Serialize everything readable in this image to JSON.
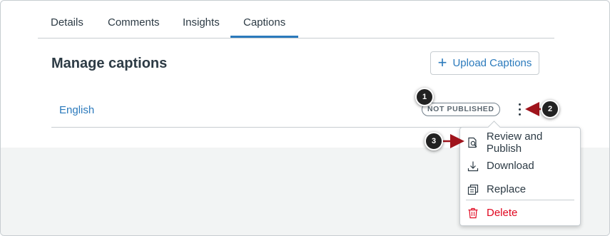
{
  "tabs": [
    {
      "label": "Details"
    },
    {
      "label": "Comments"
    },
    {
      "label": "Insights"
    },
    {
      "label": "Captions",
      "active": true
    }
  ],
  "page": {
    "title": "Manage captions",
    "upload_label": "Upload Captions"
  },
  "captions": [
    {
      "language": "English",
      "status": "NOT PUBLISHED"
    }
  ],
  "menu": {
    "items": [
      {
        "label": "Review and Publish",
        "icon": "review-icon"
      },
      {
        "label": "Download",
        "icon": "download-icon"
      },
      {
        "label": "Replace",
        "icon": "replace-icon"
      },
      {
        "label": "Delete",
        "icon": "trash-icon"
      }
    ]
  },
  "callouts": [
    "1",
    "2",
    "3"
  ],
  "colors": {
    "link": "#2b7abc",
    "danger": "#e0061f",
    "arrow": "#a0141c",
    "callout": "#222222"
  }
}
